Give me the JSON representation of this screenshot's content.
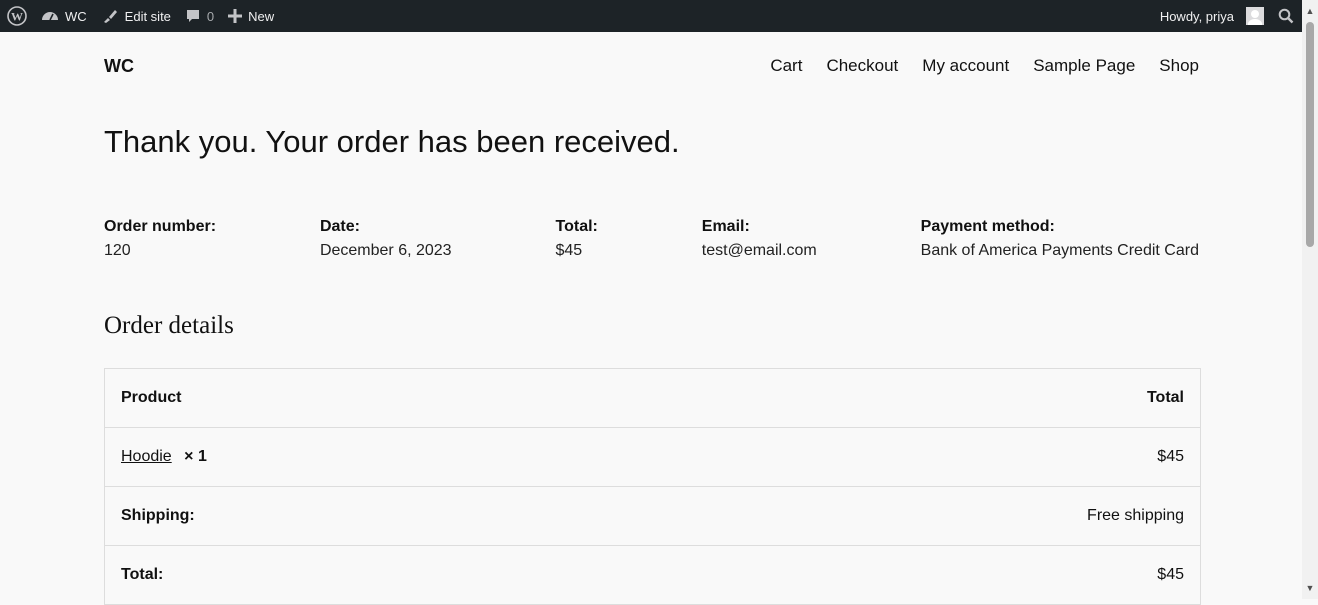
{
  "admin_bar": {
    "site_name": "WC",
    "edit_site": "Edit site",
    "comments_count": "0",
    "new_label": "New",
    "greeting": "Howdy, priya"
  },
  "header": {
    "site_title": "WC",
    "nav": [
      "Cart",
      "Checkout",
      "My account",
      "Sample Page",
      "Shop"
    ]
  },
  "confirmation": {
    "heading": "Thank you. Your order has been received."
  },
  "overview": [
    {
      "label": "Order number:",
      "value": "120"
    },
    {
      "label": "Date:",
      "value": "December 6, 2023"
    },
    {
      "label": "Total:",
      "value": "$45"
    },
    {
      "label": "Email:",
      "value": "test@email.com"
    },
    {
      "label": "Payment method:",
      "value": "Bank of America Payments Credit Card"
    }
  ],
  "order_details": {
    "title": "Order details",
    "header": {
      "product": "Product",
      "total": "Total"
    },
    "item": {
      "name": "Hoodie",
      "qty": "× 1",
      "total": "$45"
    },
    "shipping": {
      "label": "Shipping:",
      "value": "Free shipping"
    },
    "total": {
      "label": "Total:",
      "value": "$45"
    }
  },
  "colors": {
    "admin_bar_bg": "#1d2327",
    "page_bg": "#f9f9f9",
    "border": "#dddddd"
  }
}
